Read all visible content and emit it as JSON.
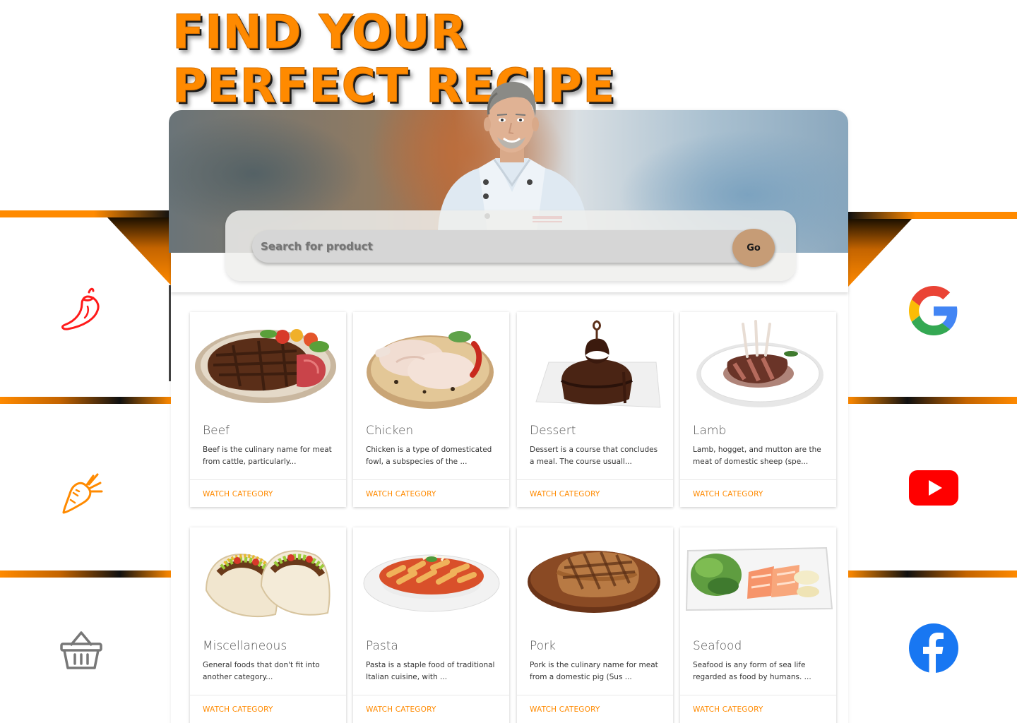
{
  "header": {
    "title": "FIND YOUR PERFECT RECIPE"
  },
  "search": {
    "placeholder": "Search for product",
    "go_label": "Go"
  },
  "left_icons": [
    {
      "name": "chili-pepper-icon",
      "color": "#ff1a1a"
    },
    {
      "name": "carrot-icon",
      "color": "#ff8a00"
    },
    {
      "name": "basket-icon",
      "color": "#777777"
    }
  ],
  "right_icons": [
    {
      "name": "google-icon"
    },
    {
      "name": "youtube-icon",
      "color": "#ff0000"
    },
    {
      "name": "facebook-icon",
      "color": "#1877f2"
    }
  ],
  "colors": {
    "accent": "#ff8a00",
    "go_button": "#c69c76"
  },
  "categories": [
    {
      "title": "Beef",
      "description": "Beef is the culinary name for meat from cattle, particularly...",
      "link": "WATCH CATEGORY"
    },
    {
      "title": "Chicken",
      "description": "Chicken is a type of domesticated fowl, a subspecies of the ...",
      "link": "WATCH CATEGORY"
    },
    {
      "title": "Dessert",
      "description": "Dessert is a course that concludes a meal. The course usuall...",
      "link": "WATCH CATEGORY"
    },
    {
      "title": "Lamb",
      "description": "Lamb, hogget, and mutton are the meat of domestic sheep (spe...",
      "link": "WATCH CATEGORY"
    },
    {
      "title": "Miscellaneous",
      "description": "General foods that don't fit into another category...",
      "link": "WATCH CATEGORY"
    },
    {
      "title": "Pasta",
      "description": "Pasta is a staple food of traditional Italian cuisine, with ...",
      "link": "WATCH CATEGORY"
    },
    {
      "title": "Pork",
      "description": "Pork is the culinary name for meat from a domestic pig (Sus ...",
      "link": "WATCH CATEGORY"
    },
    {
      "title": "Seafood",
      "description": "Seafood is any form of sea life regarded as food by humans. ...",
      "link": "WATCH CATEGORY"
    }
  ]
}
